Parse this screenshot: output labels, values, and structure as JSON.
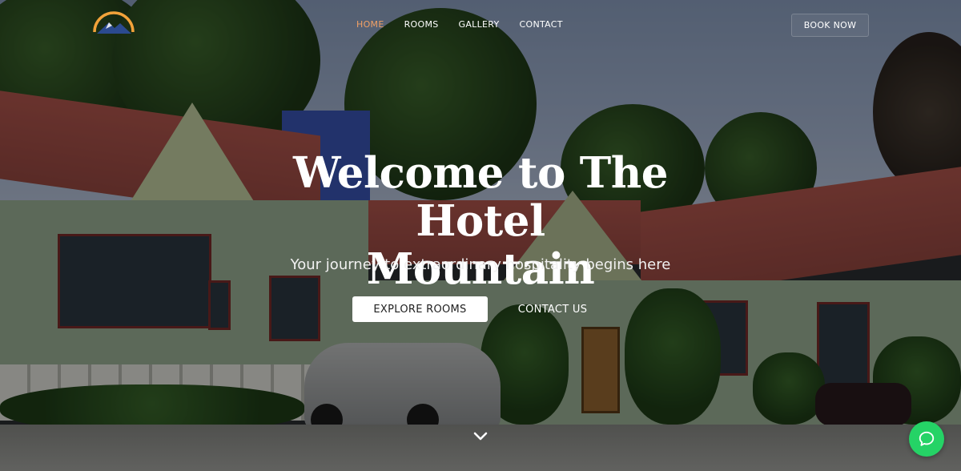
{
  "brand": {
    "logo_icon": "mountain-sun-logo",
    "accent_color": "#f0a066",
    "logo_colors": [
      "#f2a23a",
      "#2b4a8f"
    ]
  },
  "nav": {
    "items": [
      {
        "label": "HOME",
        "active": true
      },
      {
        "label": "ROOMS",
        "active": false
      },
      {
        "label": "GALLERY",
        "active": false
      },
      {
        "label": "CONTACT",
        "active": false
      }
    ],
    "book_label": "BOOK NOW"
  },
  "hero": {
    "title_line1": "Welcome to The Hotel",
    "title_line2": "Mountain",
    "subtitle": "Your journey to extraordinary hospitality begins here",
    "primary_cta": "EXPLORE ROOMS",
    "secondary_cta": "CONTACT US",
    "scroll_icon": "chevron-down-icon"
  },
  "chat": {
    "icon": "chat-bubble-icon",
    "color": "#25d366"
  }
}
